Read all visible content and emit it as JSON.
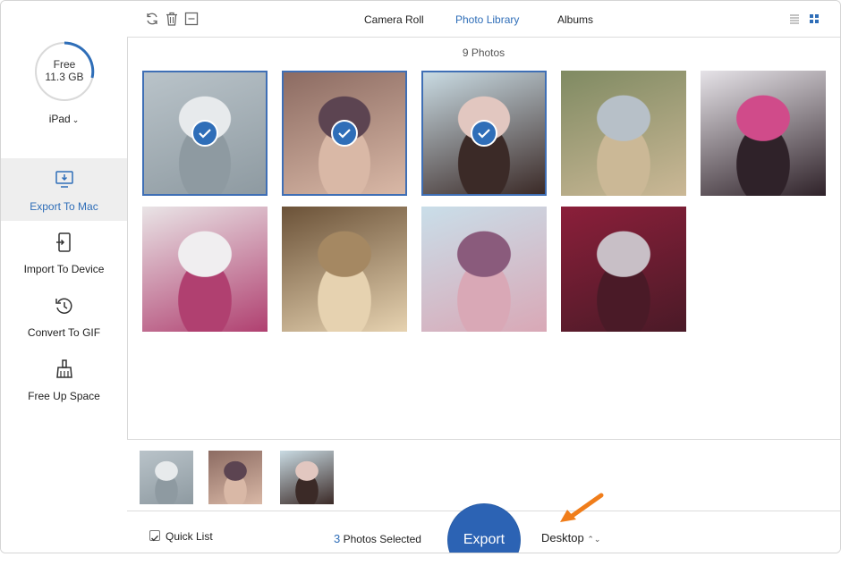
{
  "sidebar": {
    "storage": {
      "line1": "Free",
      "line2": "11.3 GB"
    },
    "device": {
      "name": "iPad",
      "chevron": "⌄"
    },
    "items": [
      {
        "label": "Export To Mac",
        "icon": "export-to-mac-icon",
        "active": true
      },
      {
        "label": "Import To Device",
        "icon": "import-to-device-icon",
        "active": false
      },
      {
        "label": "Convert To GIF",
        "icon": "convert-to-gif-icon",
        "active": false
      },
      {
        "label": "Free Up Space",
        "icon": "broom-icon",
        "active": false
      }
    ]
  },
  "toolbar": {
    "tabs": [
      {
        "label": "Camera Roll",
        "active": false
      },
      {
        "label": "Photo Library",
        "active": true
      },
      {
        "label": "Albums",
        "active": false
      }
    ]
  },
  "main": {
    "count_label": "9 Photos",
    "photos": [
      {
        "selected": true,
        "palette": [
          "#b9c3c9",
          "#8e9aa1",
          "#e7eaec"
        ]
      },
      {
        "selected": true,
        "palette": [
          "#8c6b62",
          "#d9b8a6",
          "#5c4451"
        ]
      },
      {
        "selected": true,
        "palette": [
          "#c9dbe3",
          "#3b2a27",
          "#e2c7c0"
        ]
      },
      {
        "selected": false,
        "palette": [
          "#7f8a62",
          "#cbb896",
          "#b7c0c8"
        ]
      },
      {
        "selected": false,
        "palette": [
          "#e6e3e8",
          "#2f2229",
          "#d04b8a"
        ]
      },
      {
        "selected": false,
        "palette": [
          "#e9e4e6",
          "#b04070",
          "#f0eef0"
        ]
      },
      {
        "selected": false,
        "palette": [
          "#6b5238",
          "#e6d2b0",
          "#a58862"
        ]
      },
      {
        "selected": false,
        "palette": [
          "#c9dee9",
          "#d9a8b6",
          "#8a5b7c"
        ]
      },
      {
        "selected": false,
        "palette": [
          "#8b1f3a",
          "#4a1a27",
          "#c8bfc6"
        ]
      }
    ]
  },
  "tray": {
    "thumbs": [
      {
        "palette": [
          "#b9c3c9",
          "#8e9aa1",
          "#e7eaec"
        ]
      },
      {
        "palette": [
          "#8c6b62",
          "#d9b8a6",
          "#5c4451"
        ]
      },
      {
        "palette": [
          "#c9dbe3",
          "#3b2a27",
          "#e2c7c0"
        ]
      }
    ]
  },
  "bottom": {
    "quick_list_label": "Quick List",
    "quick_list_checked": true,
    "selected_count": "3",
    "selected_suffix": " Photos Selected",
    "export_label": "Export",
    "destination": "Desktop",
    "destination_chevron": "⌃⌄"
  },
  "colors": {
    "accent": "#2f6eb8",
    "export_button": "#2c63b4",
    "arrow": "#f07d1a"
  }
}
